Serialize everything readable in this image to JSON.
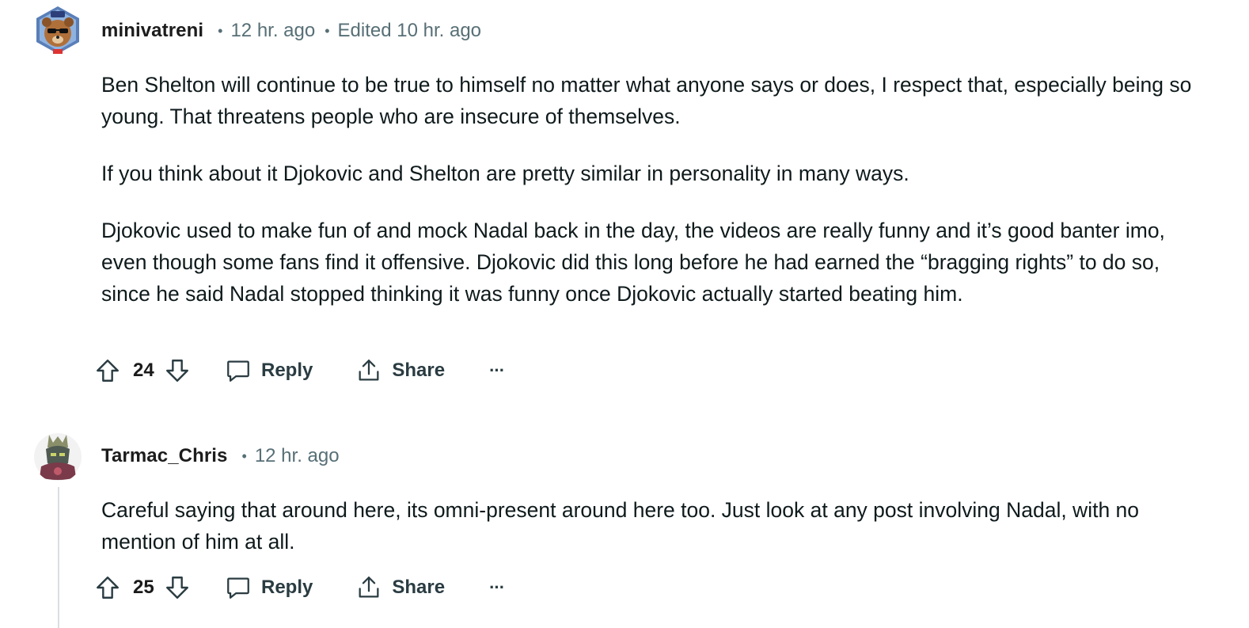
{
  "comments": [
    {
      "author": "minivatreni",
      "time": "12 hr. ago",
      "edited": "Edited 10 hr. ago",
      "paragraphs": [
        "Ben Shelton will continue to be true to himself no matter what anyone says or does, I respect that, especially being so young. That threatens people who are insecure of themselves.",
        "If you think about it Djokovic and Shelton are pretty similar in personality in many ways.",
        "Djokovic used to make fun of and mock Nadal back in the day, the videos are really funny and it’s good banter imo, even though some fans find it offensive. Djokovic did this long before he had earned the “bragging rights” to do so, since he said Nadal stopped thinking it was funny once Djokovic actually started beating him."
      ],
      "score": "24",
      "reply_label": "Reply",
      "share_label": "Share",
      "more_label": "···"
    },
    {
      "author": "Tarmac_Chris",
      "time": "12 hr. ago",
      "paragraphs": [
        "Careful saying that around here, its omni-present around here too. Just look at any post involving Nadal, with no mention of him at all."
      ],
      "score": "25",
      "reply_label": "Reply",
      "share_label": "Share",
      "more_label": "···"
    }
  ],
  "meta_separator": "•",
  "colors": {
    "meta_text": "#576f76",
    "body_text": "#0f1a1c",
    "action_text": "#2a3c42",
    "thread_line": "#d9dfe1"
  }
}
